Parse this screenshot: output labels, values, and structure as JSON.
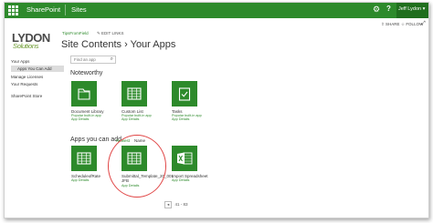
{
  "suitebar": {
    "brand": "SharePoint",
    "sites": "Sites",
    "user": "Jeff Lydon ▾"
  },
  "ribbon": {
    "share": "SHARE",
    "follow": "FOLLOW"
  },
  "logo": {
    "main": "LYDON",
    "sub": "Solutions"
  },
  "header": {
    "breadcrumb": "TipsFromField",
    "edit_links": "✎ EDIT LINKS",
    "title": "Site Contents › Your Apps"
  },
  "nav": {
    "items": [
      {
        "label": "Your Apps"
      },
      {
        "label": "Apps You Can Add"
      },
      {
        "label": "Manage Licenses"
      },
      {
        "label": "Your Requests"
      },
      {
        "label": "SharePoint Store"
      }
    ]
  },
  "search": {
    "placeholder": "Find an app"
  },
  "noteworthy": {
    "title": "Noteworthy",
    "apps": [
      {
        "label": "Document Library",
        "sub1": "Popular built-in app",
        "sub2": "App Details",
        "icon": "folder-icon"
      },
      {
        "label": "Custom List",
        "sub1": "Popular built-in app",
        "sub2": "App Details",
        "icon": "grid-icon"
      },
      {
        "label": "Tasks",
        "sub1": "Popular built-in app",
        "sub2": "App Details",
        "icon": "checkbox-icon"
      }
    ]
  },
  "can_add": {
    "title": "Apps you can add",
    "sort_newest": "Newest",
    "sort_name": "Name",
    "apps": [
      {
        "label": "ScheduleofRate",
        "sub2": "App Details",
        "icon": "grid-icon"
      },
      {
        "label": "Submittal_Template_20_001",
        "label2": "JFB",
        "sub2": "App Details",
        "icon": "grid-icon"
      },
      {
        "label": "Import Spreadsheet",
        "sub2": "App Details",
        "icon": "excel-icon"
      }
    ]
  },
  "pager": {
    "range": "41 - 83",
    "prev": "◂"
  },
  "colors": {
    "accent": "#2d8a2b",
    "highlight": "#e04545"
  }
}
